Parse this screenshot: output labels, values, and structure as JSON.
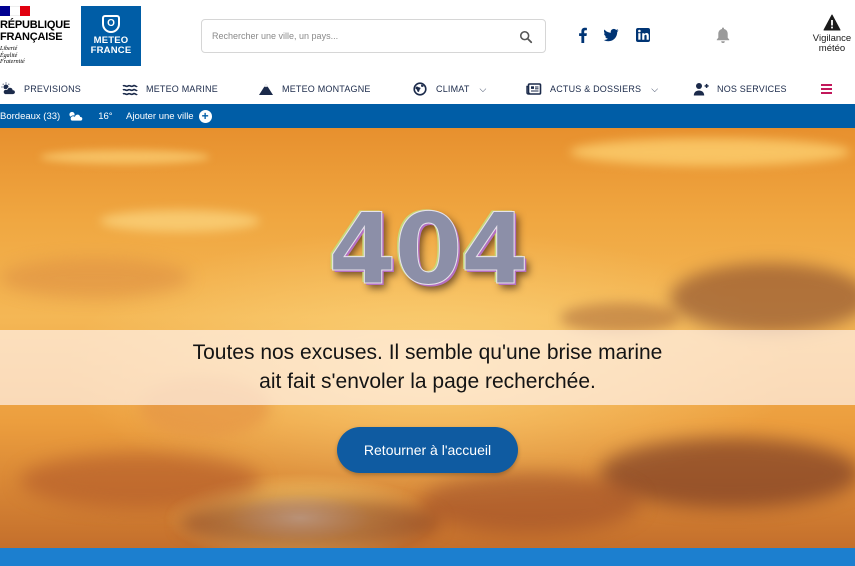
{
  "header": {
    "republic": {
      "title_lines": [
        "RÉPUBLIQUE",
        "FRANÇAISE"
      ],
      "motto_lines": [
        "Liberté",
        "Égalité",
        "Fraternité"
      ],
      "flag_colors": [
        "#000091",
        "#ffffff",
        "#e1000f"
      ]
    },
    "brand": {
      "lines": [
        "METEO",
        "FRANCE"
      ],
      "color": "#005da6",
      "emblem": "O"
    },
    "search": {
      "placeholder": "Rechercher une ville, un pays..."
    },
    "social": [
      "facebook-icon",
      "twitter-icon",
      "linkedin-icon"
    ],
    "notifications_icon": "bell-icon",
    "vigilance": {
      "lines": [
        "Vigilance",
        "météo"
      ]
    }
  },
  "nav": {
    "items": [
      {
        "label": "PREVISIONS",
        "icon": "cloud-sun-icon"
      },
      {
        "label": "METEO MARINE",
        "icon": "waves-icon"
      },
      {
        "label": "METEO MONTAGNE",
        "icon": "mountain-icon"
      },
      {
        "label": "CLIMAT",
        "icon": "globe-icon",
        "dropdown": true
      },
      {
        "label": "ACTUS & DOSSIERS",
        "icon": "newspaper-icon",
        "dropdown": true
      },
      {
        "label": "NOS SERVICES",
        "icon": "user-plus-icon"
      }
    ],
    "menu_icon": "hamburger-icon",
    "menu_color": "#c2185b"
  },
  "citybar": {
    "city": "Bordeaux (33)",
    "weather_icon": "partly-cloudy-icon",
    "temperature": "16°",
    "add_label": "Ajouter une ville",
    "background": "#005da6"
  },
  "error": {
    "code": "404",
    "message_lines": [
      "Toutes nos excuses. Il semble qu'une brise marine",
      "ait fait s'envoler la page recherchée."
    ],
    "button_label": "Retourner à l'accueil",
    "button_color": "#0f5ba1"
  }
}
